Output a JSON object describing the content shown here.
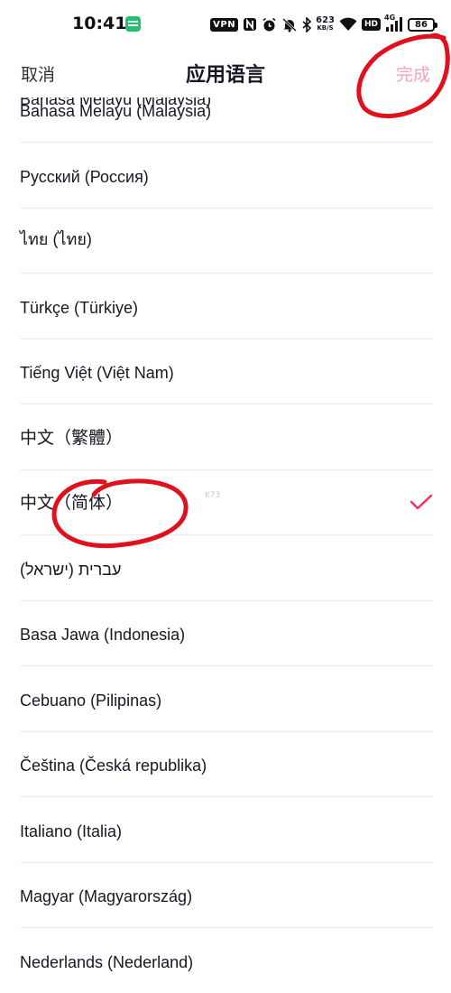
{
  "status_bar": {
    "time": "10:41",
    "vpn": "VPN",
    "net_speed_value": "623",
    "net_speed_unit": "KB/S",
    "hd": "HD",
    "signal": "4G",
    "battery": "86",
    "icons": [
      "message-app-icon",
      "vpn-icon",
      "nfc-icon",
      "alarm-icon",
      "mute-icon",
      "bluetooth-icon",
      "wifi-icon",
      "hd-icon",
      "signal-icon",
      "battery-icon"
    ]
  },
  "header": {
    "cancel_label": "取消",
    "title": "应用语言",
    "done_label": "完成",
    "done_color": "#f6a4b6"
  },
  "languages": [
    {
      "label": "Bahasa Melayu (Malaysia)",
      "selected": false
    },
    {
      "label": "Русский (Россия)",
      "selected": false
    },
    {
      "label": "ไทย (ไทย)",
      "selected": false
    },
    {
      "label": "Türkçe (Türkiye)",
      "selected": false
    },
    {
      "label": "Tiếng Việt (Việt Nam)",
      "selected": false
    },
    {
      "label": "中文（繁體）",
      "selected": false
    },
    {
      "label": "中文（简体）",
      "selected": true
    },
    {
      "label": "עברית (ישראל)",
      "selected": false
    },
    {
      "label": "Basa Jawa (Indonesia)",
      "selected": false
    },
    {
      "label": "Cebuano (Pilipinas)",
      "selected": false
    },
    {
      "label": "Čeština (Česká republika)",
      "selected": false
    },
    {
      "label": "Italiano (Italia)",
      "selected": false
    },
    {
      "label": "Magyar (Magyarország)",
      "selected": false
    },
    {
      "label": "Nederlands (Nederland)",
      "selected": false
    }
  ],
  "accent_color": "#fe2c55",
  "annotation_color": "#e0101c",
  "watermark": "K73"
}
